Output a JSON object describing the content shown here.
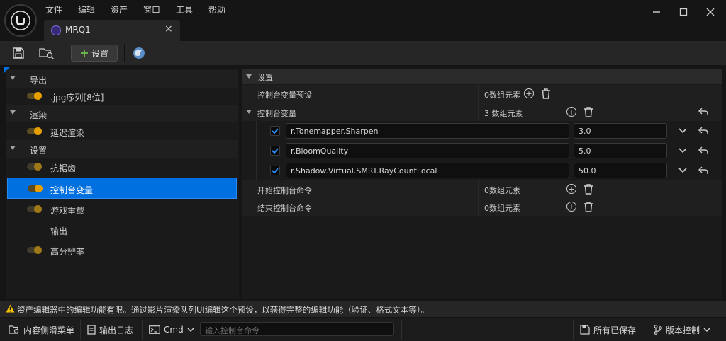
{
  "window": {
    "menu": [
      "文件",
      "编辑",
      "资产",
      "窗口",
      "工具",
      "帮助"
    ],
    "tab_title": "MRQ1",
    "tab_close": "×"
  },
  "toolbar": {
    "settings_label": "设置"
  },
  "tree": [
    {
      "kind": "category",
      "label": "导出"
    },
    {
      "kind": "item",
      "label": ".jpg序列[8位]",
      "toggle": "on"
    },
    {
      "kind": "category",
      "label": "渲染"
    },
    {
      "kind": "item",
      "label": "延迟渲染",
      "toggle": "on"
    },
    {
      "kind": "category",
      "label": "设置"
    },
    {
      "kind": "item",
      "label": "抗锯齿",
      "toggle": "dim"
    },
    {
      "kind": "item",
      "label": "控制台变量",
      "toggle": "on",
      "selected": true
    },
    {
      "kind": "item",
      "label": "游戏重载",
      "toggle": "dim"
    },
    {
      "kind": "item",
      "label": "输出",
      "toggle": "none"
    },
    {
      "kind": "item",
      "label": "高分辨率",
      "toggle": "dim"
    }
  ],
  "details": {
    "section_title": "设置",
    "preset_label": "控制台变量预设",
    "preset_value": "0数组元素",
    "cvars_label": "控制台变量",
    "cvars_value": "3 数组元素",
    "cvars": [
      {
        "name": "r.Tonemapper.Sharpen",
        "value": "3.0",
        "checked": true
      },
      {
        "name": "r.BloomQuality",
        "value": "5.0",
        "checked": true
      },
      {
        "name": "r.Shadow.Virtual.SMRT.RayCountLocal",
        "value": "50.0",
        "checked": true
      }
    ],
    "start_cmd_label": "开始控制台命令",
    "start_cmd_value": "0数组元素",
    "end_cmd_label": "结束控制台命令",
    "end_cmd_value": "0数组元素"
  },
  "notice": "资产编辑器中的编辑功能有限。通过影片渲染队列UI编辑这个预设，以获得完整的编辑功能（验证、格式文本等）。",
  "statusbar": {
    "content_drawer": "内容侧滑菜单",
    "output_log": "输出日志",
    "cmd_label": "Cmd",
    "cmd_placeholder": "输入控制台命令",
    "all_saved": "所有已保存",
    "source_control": "版本控制"
  },
  "colors": {
    "accent": "#0070e0",
    "toggle": "#e8a000",
    "warning": "#f0c000"
  }
}
